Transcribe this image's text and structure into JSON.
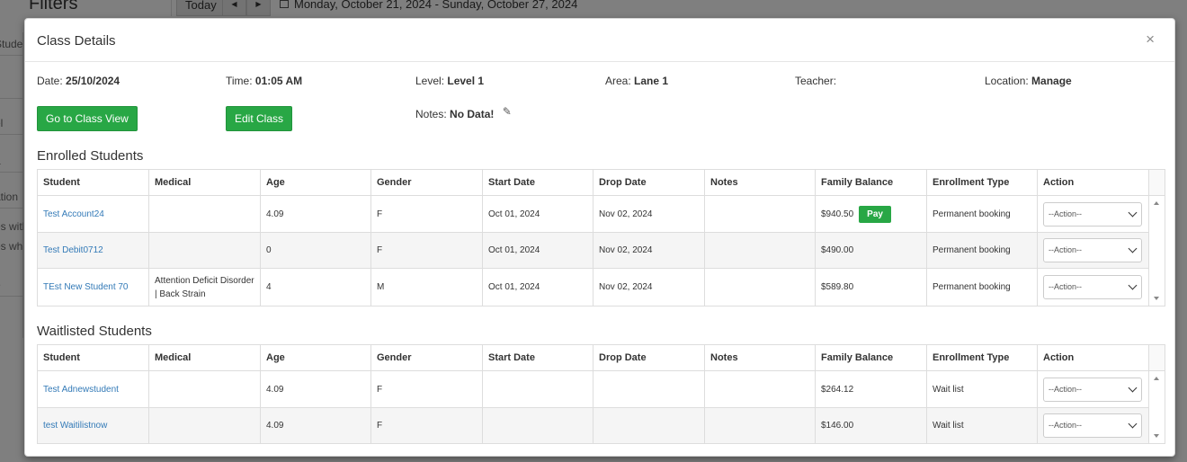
{
  "background": {
    "filters_title": "Filters",
    "today_label": "Today",
    "date_range": "Monday, October 21, 2024 - Sunday, October 27, 2024",
    "side_items": [
      "Student",
      "s",
      "el",
      "a",
      "ation",
      "es with",
      "es wh",
      "e"
    ]
  },
  "modal": {
    "title": "Class Details",
    "close": "×"
  },
  "info": {
    "date_label": "Date:",
    "date_value": "25/10/2024",
    "time_label": "Time:",
    "time_value": "01:05 AM",
    "level_label": "Level:",
    "level_value": "Level 1",
    "area_label": "Area:",
    "area_value": "Lane 1",
    "teacher_label": "Teacher:",
    "teacher_value": "",
    "location_label": "Location:",
    "location_value": "Manage",
    "notes_label": "Notes:",
    "notes_value": "No Data!"
  },
  "buttons": {
    "go_to_class_view": "Go to Class View",
    "edit_class": "Edit Class",
    "pay": "Pay"
  },
  "enrolled": {
    "title": "Enrolled Students",
    "columns": [
      "Student",
      "Medical",
      "Age",
      "Gender",
      "Start Date",
      "Drop Date",
      "Notes",
      "Family Balance",
      "Enrollment Type",
      "Action"
    ],
    "rows": [
      {
        "student": "Test Account24",
        "medical": "",
        "age": "4.09",
        "gender": "F",
        "start": "Oct 01, 2024",
        "drop": "Nov 02, 2024",
        "notes": "",
        "balance": "$940.50",
        "type": "Permanent booking",
        "action": "--Action--"
      },
      {
        "student": "Test Debit0712",
        "medical": "",
        "age": "0",
        "gender": "F",
        "start": "Oct 01, 2024",
        "drop": "Nov 02, 2024",
        "notes": "",
        "balance": "$490.00",
        "type": "Permanent booking",
        "action": "--Action--"
      },
      {
        "student": "TEst New Student 70",
        "medical": "Attention Deficit Disorder | Back Strain",
        "age": "4",
        "gender": "M",
        "start": "Oct 01, 2024",
        "drop": "Nov 02, 2024",
        "notes": "",
        "balance": "$589.80",
        "type": "Permanent booking",
        "action": "--Action--"
      }
    ]
  },
  "waitlisted": {
    "title": "Waitlisted Students",
    "columns": [
      "Student",
      "Medical",
      "Age",
      "Gender",
      "Start Date",
      "Drop Date",
      "Notes",
      "Family Balance",
      "Enrollment Type",
      "Action"
    ],
    "rows": [
      {
        "student": "Test Adnewstudent",
        "medical": "",
        "age": "4.09",
        "gender": "F",
        "start": "",
        "drop": "",
        "notes": "",
        "balance": "$264.12",
        "type": "Wait list",
        "action": "--Action--"
      },
      {
        "student": "test Waitilistnow",
        "medical": "",
        "age": "4.09",
        "gender": "F",
        "start": "",
        "drop": "",
        "notes": "",
        "balance": "$146.00",
        "type": "Wait list",
        "action": "--Action--"
      }
    ]
  },
  "colors": {
    "green": "#28a745",
    "link": "#337ab7"
  }
}
